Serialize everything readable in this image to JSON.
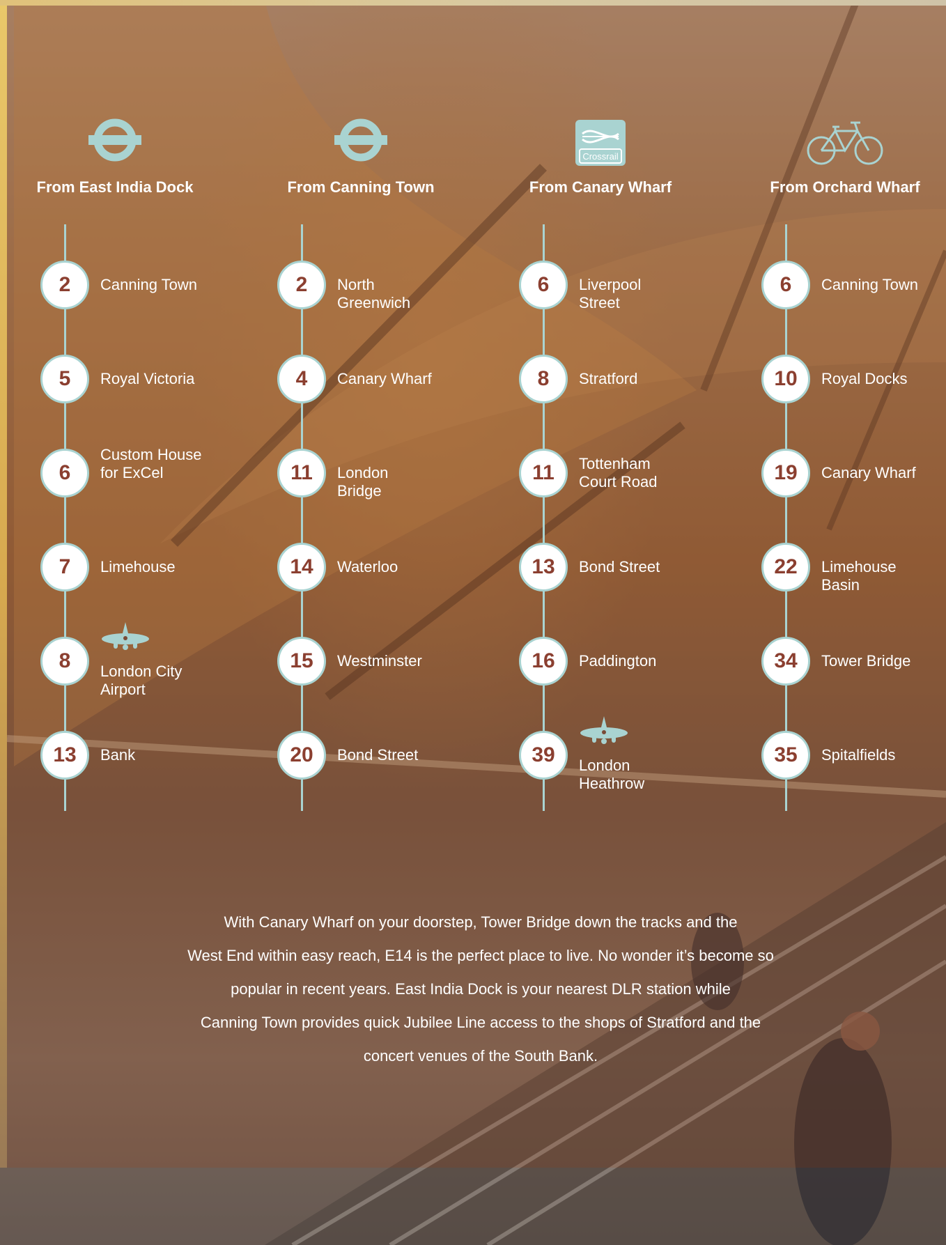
{
  "columns": [
    {
      "title": "From East India Dock",
      "icon": "underground-roundel-icon",
      "stops": [
        {
          "minutes": "2",
          "label": "Canning Town"
        },
        {
          "minutes": "5",
          "label": "Royal Victoria"
        },
        {
          "minutes": "6",
          "label": "Custom House for ExCel"
        },
        {
          "minutes": "7",
          "label": "Limehouse"
        },
        {
          "minutes": "8",
          "label": "London City Airport",
          "icon": "airplane-icon"
        },
        {
          "minutes": "13",
          "label": "Bank"
        }
      ]
    },
    {
      "title": "From Canning Town",
      "icon": "underground-roundel-icon",
      "stops": [
        {
          "minutes": "2",
          "label": "North Greenwich"
        },
        {
          "minutes": "4",
          "label": "Canary Wharf"
        },
        {
          "minutes": "11",
          "label": "London Bridge"
        },
        {
          "minutes": "14",
          "label": "Waterloo"
        },
        {
          "minutes": "15",
          "label": "Westminster"
        },
        {
          "minutes": "20",
          "label": "Bond Street"
        }
      ]
    },
    {
      "title": "From Canary Wharf",
      "icon": "crossrail-icon",
      "icon_text": "Crossrail",
      "stops": [
        {
          "minutes": "6",
          "label": "Liverpool Street"
        },
        {
          "minutes": "8",
          "label": "Stratford"
        },
        {
          "minutes": "11",
          "label": "Tottenham Court Road"
        },
        {
          "minutes": "13",
          "label": "Bond Street"
        },
        {
          "minutes": "16",
          "label": "Paddington"
        },
        {
          "minutes": "39",
          "label": "London Heathrow",
          "icon": "airplane-icon"
        }
      ]
    },
    {
      "title": "From Orchard Wharf",
      "icon": "bicycle-icon",
      "stops": [
        {
          "minutes": "6",
          "label": "Canning Town"
        },
        {
          "minutes": "10",
          "label": "Royal Docks"
        },
        {
          "minutes": "19",
          "label": "Canary Wharf"
        },
        {
          "minutes": "22",
          "label": "Limehouse Basin"
        },
        {
          "minutes": "34",
          "label": "Tower Bridge"
        },
        {
          "minutes": "35",
          "label": "Spitalfields"
        }
      ]
    }
  ],
  "paragraph": {
    "lines": [
      "With Canary Wharf on your doorstep, Tower Bridge down the tracks and the",
      "West End within easy reach, E14 is the perfect place to live. No wonder it’s become so",
      "popular in recent years.  East India Dock is your nearest DLR station while",
      "Canning Town provides quick Jubilee Line access to the shops of Stratford and the",
      "concert venues of the South Bank."
    ]
  },
  "colors": {
    "accent": "#a9d3d1",
    "number": "#8b3f30",
    "text": "#ffffff"
  }
}
